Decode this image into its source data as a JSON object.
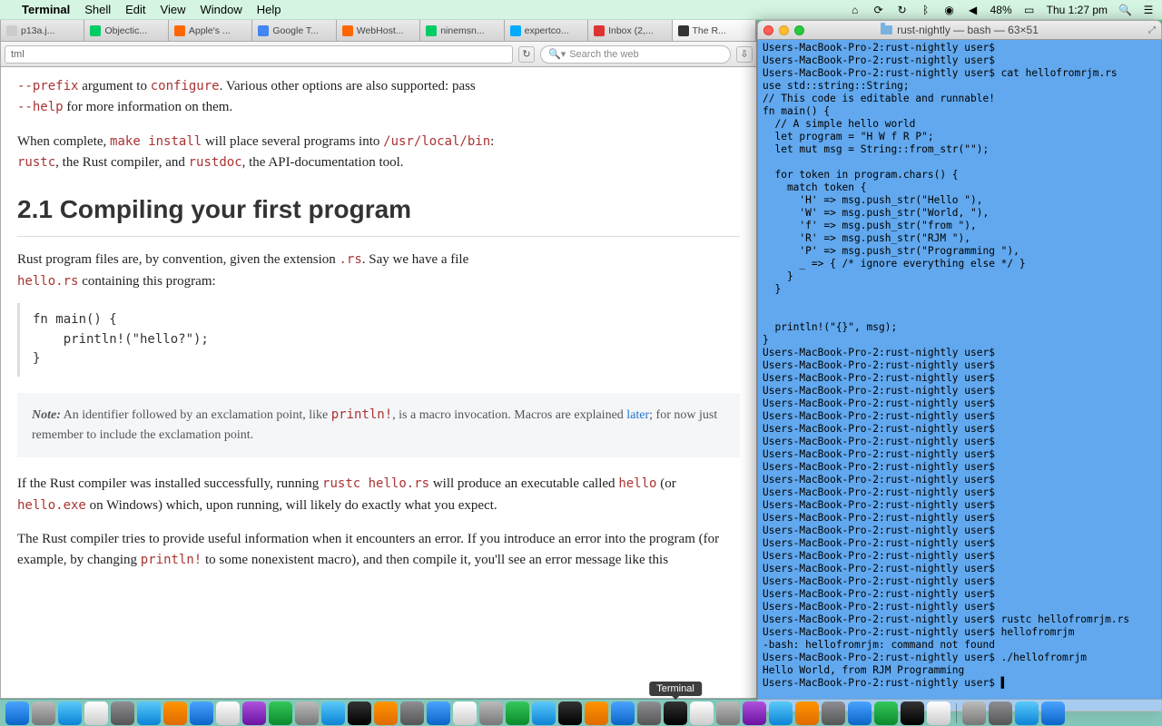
{
  "menubar": {
    "app": "Terminal",
    "items": [
      "Shell",
      "Edit",
      "View",
      "Window",
      "Help"
    ],
    "battery": "48%",
    "clock": "Thu 1:27 pm"
  },
  "browser": {
    "tabs": [
      {
        "label": "p13a.j..."
      },
      {
        "label": "Objectic..."
      },
      {
        "label": "Apple's ..."
      },
      {
        "label": "Google T..."
      },
      {
        "label": "WebHost..."
      },
      {
        "label": "ninemsn..."
      },
      {
        "label": "expertco..."
      },
      {
        "label": "Inbox (2,..."
      },
      {
        "label": "The R...",
        "active": true
      }
    ],
    "url_suffix": "tml",
    "search_placeholder": "Search the web",
    "page": {
      "p1_a": "--prefix",
      "p1_b": " argument to ",
      "p1_c": "configure",
      "p1_d": ". Various other options are also supported: pass ",
      "p1_e": "--help",
      "p1_f": " for more information on them.",
      "p2_a": "When complete, ",
      "p2_b": "make install",
      "p2_c": " will place several programs into ",
      "p2_d": "/usr/local/bin",
      "p2_e": ": ",
      "p2_f": "rustc",
      "p2_g": ", the Rust compiler, and ",
      "p2_h": "rustdoc",
      "p2_i": ", the API-documentation tool.",
      "h2": "2.1 Compiling your first program",
      "p3_a": "Rust program files are, by convention, given the extension ",
      "p3_b": ".rs",
      "p3_c": ". Say we have a file ",
      "p3_d": "hello.rs",
      "p3_e": " containing this program:",
      "code": "fn main() {\n    println!(\"hello?\");\n}",
      "note_b": "Note:",
      "note_1": " An identifier followed by an exclamation point, like ",
      "note_c": "println!",
      "note_2": ", is a macro invocation. Macros are explained ",
      "note_link": "later",
      "note_3": "; for now just remember to include the exclamation point.",
      "p4_a": "If the Rust compiler was installed successfully, running ",
      "p4_b": "rustc hello.rs",
      "p4_c": " will produce an executable called ",
      "p4_d": "hello",
      "p4_e": " (or ",
      "p4_f": "hello.exe",
      "p4_g": " on Windows) which, upon running, will likely do exactly what you expect.",
      "p5": "The Rust compiler tries to provide useful information when it encounters an error. If you introduce an error into the program (for example, by changing ",
      "p5_b": "println!",
      "p5_c": " to some nonexistent macro), and then compile it, you'll see an error message like this"
    }
  },
  "terminal": {
    "title": "rust-nightly — bash — 63×51",
    "lines": [
      "Users-MacBook-Pro-2:rust-nightly user$",
      "Users-MacBook-Pro-2:rust-nightly user$",
      "Users-MacBook-Pro-2:rust-nightly user$ cat hellofromrjm.rs",
      "use std::string::String;",
      "// This code is editable and runnable!",
      "fn main() {",
      "  // A simple hello world",
      "  let program = \"H W f R P\";",
      "  let mut msg = String::from_str(\"\");",
      "",
      "  for token in program.chars() {",
      "    match token {",
      "      'H' => msg.push_str(\"Hello \"),",
      "      'W' => msg.push_str(\"World, \"),",
      "      'f' => msg.push_str(\"from \"),",
      "      'R' => msg.push_str(\"RJM \"),",
      "      'P' => msg.push_str(\"Programming \"),",
      "      _ => { /* ignore everything else */ }",
      "    }",
      "  }",
      "",
      "",
      "  println!(\"{}\", msg);",
      "}",
      "Users-MacBook-Pro-2:rust-nightly user$",
      "Users-MacBook-Pro-2:rust-nightly user$",
      "Users-MacBook-Pro-2:rust-nightly user$",
      "Users-MacBook-Pro-2:rust-nightly user$",
      "Users-MacBook-Pro-2:rust-nightly user$",
      "Users-MacBook-Pro-2:rust-nightly user$",
      "Users-MacBook-Pro-2:rust-nightly user$",
      "Users-MacBook-Pro-2:rust-nightly user$",
      "Users-MacBook-Pro-2:rust-nightly user$",
      "Users-MacBook-Pro-2:rust-nightly user$",
      "Users-MacBook-Pro-2:rust-nightly user$",
      "Users-MacBook-Pro-2:rust-nightly user$",
      "Users-MacBook-Pro-2:rust-nightly user$",
      "Users-MacBook-Pro-2:rust-nightly user$",
      "Users-MacBook-Pro-2:rust-nightly user$",
      "Users-MacBook-Pro-2:rust-nightly user$",
      "Users-MacBook-Pro-2:rust-nightly user$",
      "Users-MacBook-Pro-2:rust-nightly user$",
      "Users-MacBook-Pro-2:rust-nightly user$",
      "Users-MacBook-Pro-2:rust-nightly user$",
      "Users-MacBook-Pro-2:rust-nightly user$",
      "Users-MacBook-Pro-2:rust-nightly user$ rustc hellofromrjm.rs",
      "Users-MacBook-Pro-2:rust-nightly user$ hellofromrjm",
      "-bash: hellofromrjm: command not found",
      "Users-MacBook-Pro-2:rust-nightly user$ ./hellofromrjm",
      "Hello World, from RJM Programming",
      "Users-MacBook-Pro-2:rust-nightly user$ ▌"
    ]
  },
  "dock": {
    "hover_label": "Terminal"
  }
}
